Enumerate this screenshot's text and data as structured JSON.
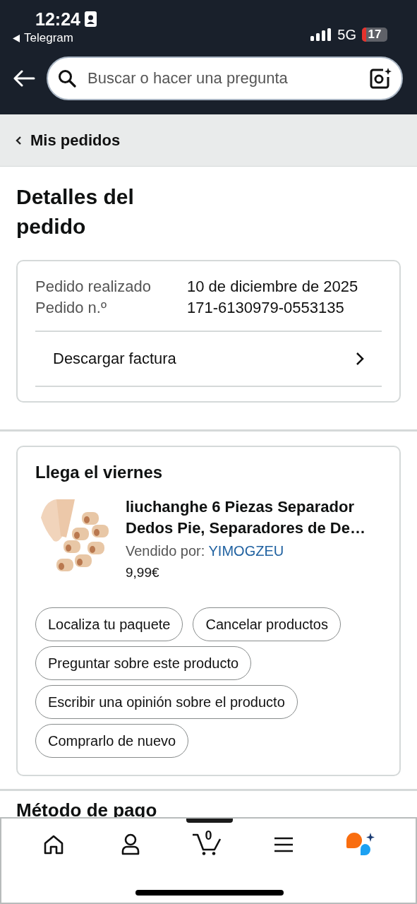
{
  "status_bar": {
    "time": "12:24",
    "back_app": "Telegram",
    "network": "5G",
    "battery": "17"
  },
  "search": {
    "placeholder": "Buscar o hacer una pregunta"
  },
  "breadcrumb": "Mis pedidos",
  "title": "Detalles del pedido",
  "order_info": {
    "rows": [
      {
        "label": "Pedido realizado",
        "value": "10 de diciembre de 2025"
      },
      {
        "label": "Pedido n.º",
        "value": "171-6130979-0553135"
      }
    ],
    "link": "Descargar factura"
  },
  "shipment": {
    "heading": "Llega el viernes",
    "product": {
      "kind": "picture",
      "title": "liuchanghe 6 Piezas Separador Dedos Pie, Separadores de De…",
      "seller_label": "Vendido por:",
      "seller": "YIMOGZEU",
      "price": "9,99€"
    },
    "actions": [
      "Localiza tu paquete",
      "Cancelar productos",
      "Preguntar sobre este producto",
      "Escribir una opinión sobre el producto",
      "Comprarlo de nuevo"
    ]
  },
  "next_section": "Método de pago",
  "bottom_nav": [
    {
      "kind": "home"
    },
    {
      "kind": "account"
    },
    {
      "kind": "cart",
      "count": "0"
    },
    {
      "kind": "menu"
    },
    {
      "kind": "assistant"
    }
  ]
}
